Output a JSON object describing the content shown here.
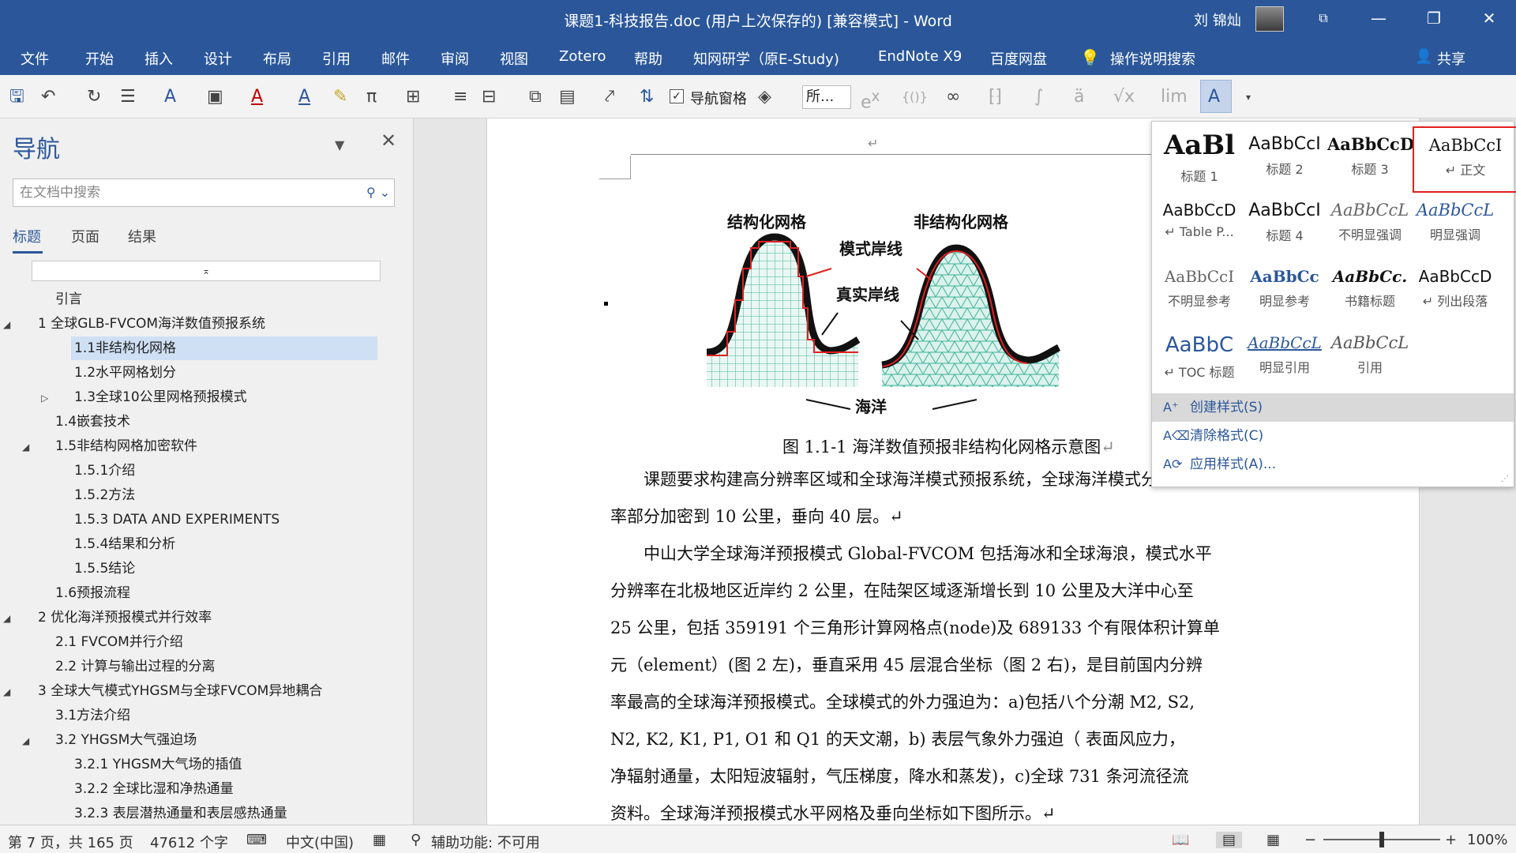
{
  "window": {
    "title": "课题1-科技报告.doc (用户上次保存的) [兼容模式] - Word",
    "user": "刘 锦灿",
    "minimize_icon": "—",
    "restore_icon": "❐",
    "close_icon": "✕",
    "ribbon_display_icon": "⧉"
  },
  "ribbon": {
    "tabs": [
      "文件",
      "开始",
      "插入",
      "设计",
      "布局",
      "引用",
      "邮件",
      "审阅",
      "视图",
      "Zotero",
      "帮助",
      "知网研学（原E-Study)",
      "EndNote X9",
      "百度网盘",
      "操作说明搜索"
    ],
    "share": "共享"
  },
  "toolbar": {
    "nav_pane_label": "导航窗格",
    "nav_pane_checked": "✓",
    "font_combo": "所...",
    "icons": [
      "save-icon",
      "undo-icon",
      "redo-icon",
      "list-icon",
      "text-effects-icon",
      "picture-icon",
      "font-color-icon",
      "text-highlight-icon",
      "format-painter-icon",
      "equation-icon",
      "borders-icon",
      "align-icon",
      "table-icon",
      "sort-icon",
      "styles-icon"
    ]
  },
  "nav": {
    "title": "导航",
    "search_placeholder": "在文档中搜索",
    "tabs": [
      "标题",
      "页面",
      "结果"
    ],
    "collapse_glyph": "⌅",
    "outline": [
      {
        "text": "引言",
        "level": 1
      },
      {
        "text": "1 全球GLB-FVCOM海洋数值预报系统",
        "level": 0,
        "toggle": "◢"
      },
      {
        "text": "1.1非结构化网格",
        "level": 2,
        "selected": true
      },
      {
        "text": "1.2水平网格划分",
        "level": 2
      },
      {
        "text": "1.3全球10公里网格预报模式",
        "level": 2,
        "toggle": "▷"
      },
      {
        "text": "1.4嵌套技术",
        "level": 1
      },
      {
        "text": "1.5非结构网格加密软件",
        "level": 1,
        "toggle": "◢"
      },
      {
        "text": "1.5.1介绍",
        "level": 2
      },
      {
        "text": "1.5.2方法",
        "level": 2
      },
      {
        "text": "1.5.3 DATA AND EXPERIMENTS",
        "level": 2
      },
      {
        "text": "1.5.4结果和分析",
        "level": 2
      },
      {
        "text": "1.5.5结论",
        "level": 2
      },
      {
        "text": "1.6预报流程",
        "level": 1
      },
      {
        "text": "2 优化海洋预报模式并行效率",
        "level": 0,
        "toggle": "◢"
      },
      {
        "text": "2.1 FVCOM并行介绍",
        "level": 1
      },
      {
        "text": "2.2 计算与输出过程的分离",
        "level": 1
      },
      {
        "text": "3 全球大气模式YHGSM与全球FVCOM异地耦合",
        "level": 0,
        "toggle": "◢"
      },
      {
        "text": "3.1方法介绍",
        "level": 1
      },
      {
        "text": "3.2 YHGSM大气强迫场",
        "level": 1,
        "toggle": "◢"
      },
      {
        "text": "3.2.1 YHGSM大气场的插值",
        "level": 2
      },
      {
        "text": "3.2.2 全球比湿和净热通量",
        "level": 2
      },
      {
        "text": "3.2.3 表层潜热通量和表层感热通量",
        "level": 2
      }
    ]
  },
  "document": {
    "return_mark": "↵",
    "figure": {
      "label_structured": "结构化网格",
      "label_unstructured": "非结构化网格",
      "label_model_coast": "模式岸线",
      "label_real_coast": "真实岸线",
      "label_ocean": "海洋"
    },
    "caption": "图 1.1-1 海洋数值预报非结构化网格示意图",
    "paragraphs": [
      [
        "课题要求构建高分辨率区域和全球海洋模式预报系统，全球海洋模式分辨",
        "率部分加密到 10 公里，垂向 40 层。↵"
      ],
      [
        "中山大学全球海洋预报模式 Global-FVCOM 包括海冰和全球海浪，模式水平",
        "分辨率在北极地区近岸约 2 公里，在陆架区域逐渐增长到 10 公里及大洋中心至",
        "25 公里，包括 359191 个三角形计算网格点(node)及 689133 个有限体积计算单",
        "元（element）(图 2 左)，垂直采用 45 层混合坐标（图 2 右)，是目前国内分辨",
        "率最高的全球海洋预报模式。全球模式的外力强迫为：a)包括八个分潮 M2, S2,",
        "N2, K2, K1, P1, O1 和 Q1 的天文潮，b) 表层气象外力强迫（ 表面风应力，",
        "净辐射通量，太阳短波辐射，气压梯度，降水和蒸发)，c)全球 731 条河流径流",
        "资料。全球海洋预报模式水平网格及垂向坐标如下图所示。↵"
      ]
    ]
  },
  "styles_gallery": {
    "items": [
      {
        "preview": "AaBl",
        "label": "标题 1"
      },
      {
        "preview": "AaBbCcI",
        "label": "标题 2"
      },
      {
        "preview": "AaBbCcD",
        "label": "标题 3"
      },
      {
        "preview": "AaBbCcI",
        "label": "↵ 正文",
        "selected": true
      },
      {
        "preview": "AaBbCcD",
        "label": "↵ Table P..."
      },
      {
        "preview": "AaBbCcI",
        "label": "标题 4"
      },
      {
        "preview": "AaBbCcL",
        "label": "不明显强调"
      },
      {
        "preview": "AaBbCcL",
        "label": "明显强调"
      },
      {
        "preview": "AaBbCcI",
        "label": "不明显参考"
      },
      {
        "preview": "AaBbCc",
        "label": "明显参考"
      },
      {
        "preview": "AaBbCc.",
        "label": "书籍标题"
      },
      {
        "preview": "AaBbCcD",
        "label": "↵ 列出段落"
      },
      {
        "preview": "AaBbC",
        "label": "↵ TOC 标题"
      },
      {
        "preview": "AaBbCcL",
        "label": "明显引用"
      },
      {
        "preview": "AaBbCcL",
        "label": "引用"
      }
    ],
    "menu": [
      "创建样式(S)",
      "清除格式(C)",
      "应用样式(A)..."
    ]
  },
  "status": {
    "page": "第 7 页，共 165 页",
    "words": "47612 个字",
    "language": "中文(中国)",
    "accessibility": "辅助功能: 不可用",
    "zoom": "100%",
    "zoom_level": 1.0
  },
  "colors": {
    "accent": "#2b579a",
    "selection_border": "#e02020",
    "mesh_green": "#3fb39a"
  }
}
